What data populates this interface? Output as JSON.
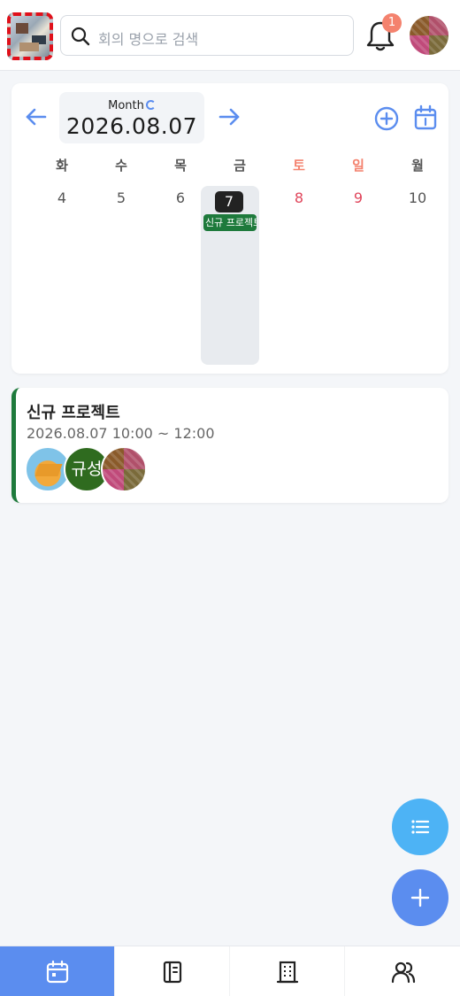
{
  "header": {
    "search_placeholder": "회의 명으로 검색",
    "notification_count": "1"
  },
  "calendar": {
    "mode_label": "Month",
    "current_date": "2026.08.07",
    "weekdays": [
      "화",
      "수",
      "목",
      "금",
      "토",
      "일",
      "월"
    ],
    "days": [
      "4",
      "5",
      "6",
      "7",
      "8",
      "9",
      "10"
    ],
    "selected_index": 3,
    "event_chip_label": "신규 프로젝트"
  },
  "event": {
    "title": "신규 프로젝트",
    "time": "2026.08.07 10:00 ~ 12:00",
    "attendee_initials": "규성"
  },
  "bottom_nav": {
    "tabs": [
      "calendar-icon",
      "notebook-icon",
      "building-icon",
      "users-icon"
    ],
    "active_index": 0
  },
  "colors": {
    "accent": "#5b8def",
    "saturday": "#f4826e",
    "sunday": "#e0455b",
    "event_green": "#1e7a3c"
  }
}
